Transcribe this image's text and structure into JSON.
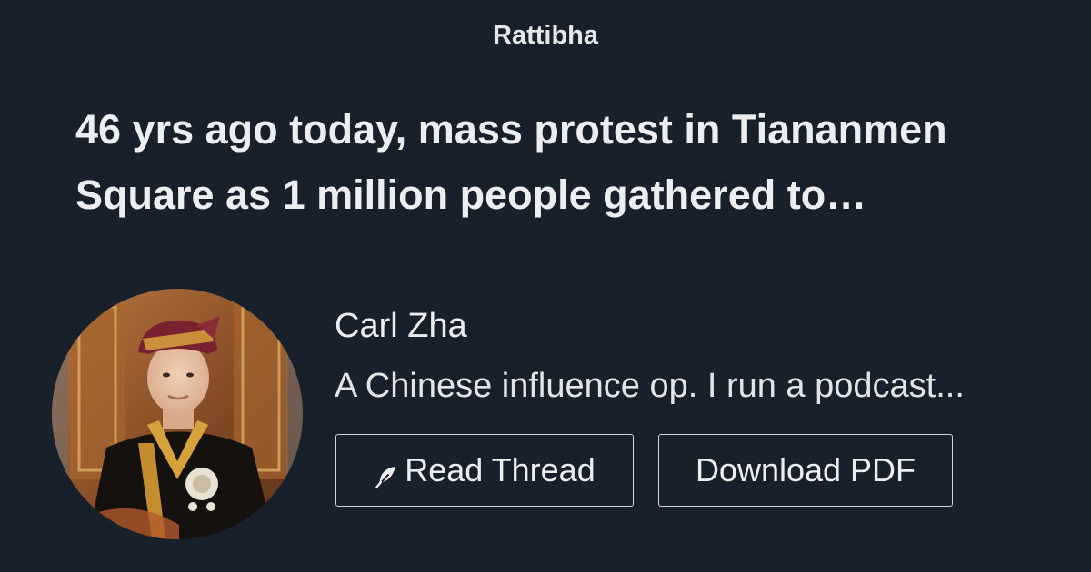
{
  "site": {
    "brand": "Rattibha"
  },
  "thread": {
    "title": "46 yrs ago today, mass protest in Tiananmen Square as 1 million people gathered to…"
  },
  "author": {
    "name": "Carl Zha",
    "bio": "A Chinese influence op. I run a podcast..."
  },
  "actions": {
    "read_label": "Read Thread",
    "read_icon": "feather-icon",
    "pdf_label": "Download PDF"
  },
  "colors": {
    "background": "#18202c",
    "text": "#eceef1",
    "button_border": "#cfd3d9"
  }
}
